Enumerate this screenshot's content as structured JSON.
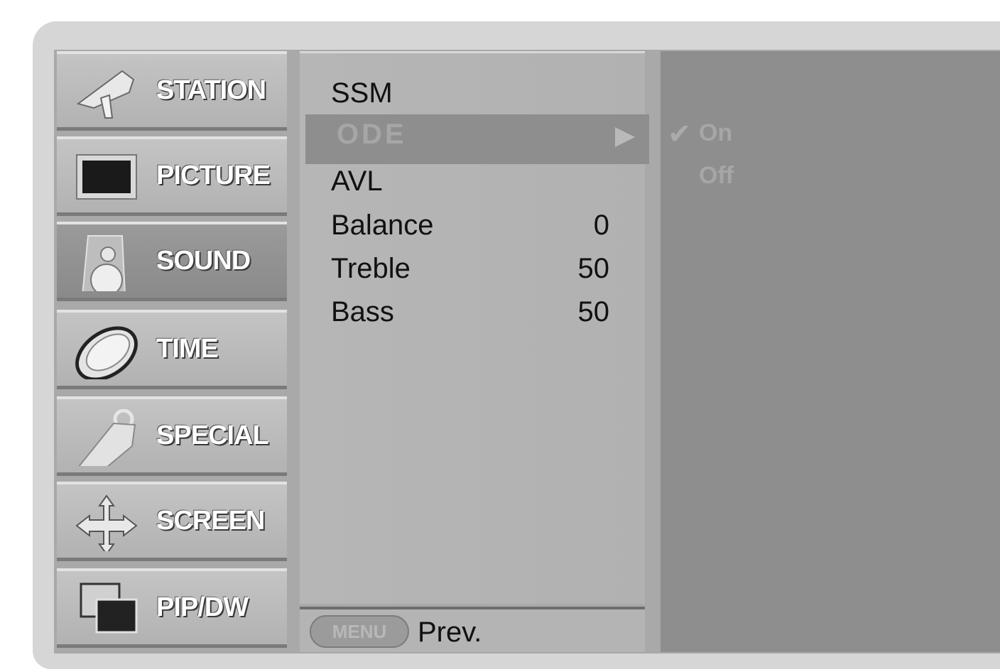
{
  "sidebar": {
    "items": [
      {
        "label": "STATION",
        "icon": "satellite-dish-icon",
        "active": false
      },
      {
        "label": "PICTURE",
        "icon": "tv-screen-icon",
        "active": false
      },
      {
        "label": "SOUND",
        "icon": "speaker-icon",
        "active": true
      },
      {
        "label": "TIME",
        "icon": "clock-icon",
        "active": false
      },
      {
        "label": "SPECIAL",
        "icon": "key-tag-icon",
        "active": false
      },
      {
        "label": "SCREEN",
        "icon": "move-arrows-icon",
        "active": false
      },
      {
        "label": "PIP/DW",
        "icon": "pip-windows-icon",
        "active": false
      }
    ]
  },
  "submenu": {
    "items": [
      {
        "label": "SSM",
        "value": ""
      },
      {
        "label": "ODE",
        "value": ""
      },
      {
        "label": "AVL",
        "value": ""
      },
      {
        "label": "Balance",
        "value": "0"
      },
      {
        "label": "Treble",
        "value": "50"
      },
      {
        "label": "Bass",
        "value": "50"
      }
    ],
    "selected_index": 1
  },
  "options": {
    "items": [
      "On",
      "Off"
    ],
    "selected": "On"
  },
  "footer": {
    "button_label": "MENU",
    "prev_label": "Prev."
  },
  "colors": {
    "highlight": "#8e8e8e",
    "panel": "#b3b3b3",
    "text": "#111111"
  }
}
